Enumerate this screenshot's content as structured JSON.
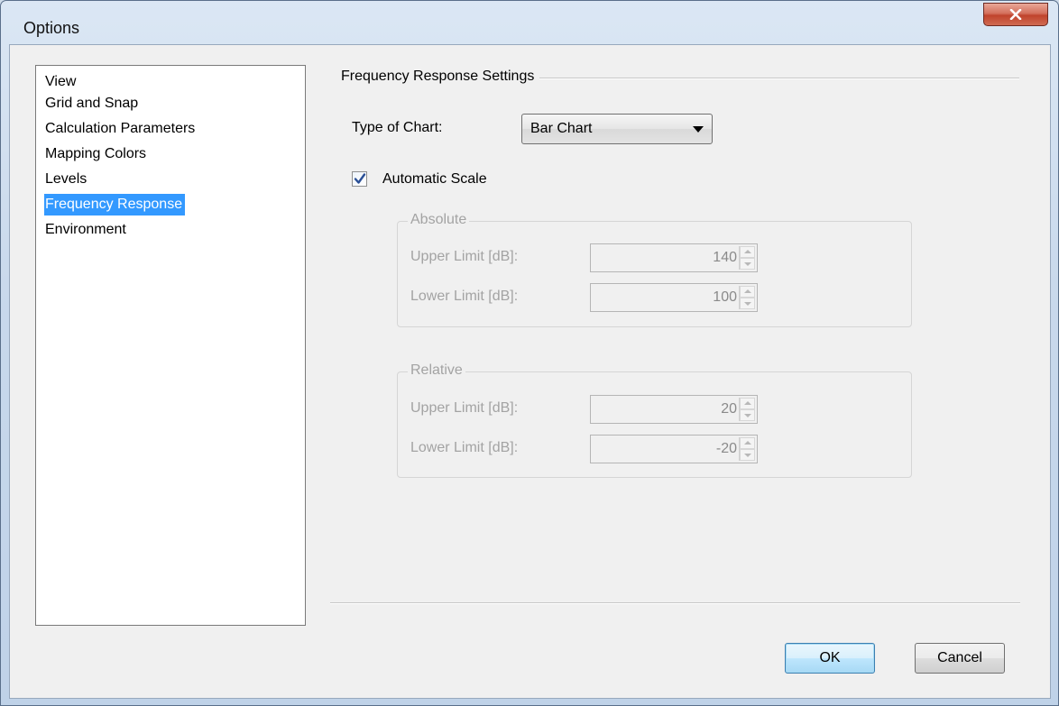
{
  "window": {
    "title": "Options",
    "close_glyph": "X"
  },
  "nav": {
    "items": [
      {
        "label": "View"
      },
      {
        "label": "Grid and Snap"
      },
      {
        "label": "Calculation Parameters"
      },
      {
        "label": "Mapping Colors"
      },
      {
        "label": "Levels"
      },
      {
        "label": "Frequency Response"
      },
      {
        "label": "Environment"
      }
    ],
    "selected": "Frequency Response",
    "selection_color": "#3399ff"
  },
  "panel": {
    "group_title": "Frequency Response Settings",
    "chart_type_label": "Type of Chart:",
    "chart_type_value": "Bar Chart",
    "auto_scale_label": "Automatic Scale",
    "auto_scale_checked": true,
    "absolute": {
      "legend": "Absolute",
      "upper_label": "Upper Limit [dB]:",
      "upper_value": "140",
      "lower_label": "Lower Limit [dB]:",
      "lower_value": "100"
    },
    "relative": {
      "legend": "Relative",
      "upper_label": "Upper Limit [dB]:",
      "upper_value": "20",
      "lower_label": "Lower Limit [dB]:",
      "lower_value": "-20"
    }
  },
  "buttons": {
    "ok": "OK",
    "cancel": "Cancel"
  }
}
